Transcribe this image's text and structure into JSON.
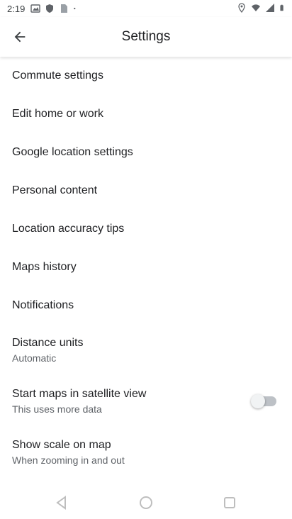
{
  "status_bar": {
    "time": "2:19",
    "left_icons": [
      "photos-icon",
      "play-protect-icon",
      "sim-card-icon",
      "dot-icon"
    ],
    "right_icons": [
      "location-icon",
      "wifi-icon",
      "signal-icon",
      "battery-icon"
    ]
  },
  "app_bar": {
    "title": "Settings",
    "back_icon": "arrow-back-icon"
  },
  "settings": {
    "items": [
      {
        "title": "Commute settings"
      },
      {
        "title": "Edit home or work"
      },
      {
        "title": "Google location settings"
      },
      {
        "title": "Personal content"
      },
      {
        "title": "Location accuracy tips"
      },
      {
        "title": "Maps history"
      },
      {
        "title": "Notifications"
      },
      {
        "title": "Distance units",
        "subtitle": "Automatic"
      },
      {
        "title": "Start maps in satellite view",
        "subtitle": "This uses more data",
        "toggle": false
      },
      {
        "title": "Show scale on map",
        "subtitle": "When zooming in and out"
      }
    ]
  },
  "nav_bar": {
    "buttons": [
      "back-triangle-icon",
      "home-circle-icon",
      "recents-square-icon"
    ]
  },
  "colors": {
    "text_primary": "#202124",
    "text_secondary": "#5f6368",
    "toggle_off_track": "#bdc1c6"
  }
}
